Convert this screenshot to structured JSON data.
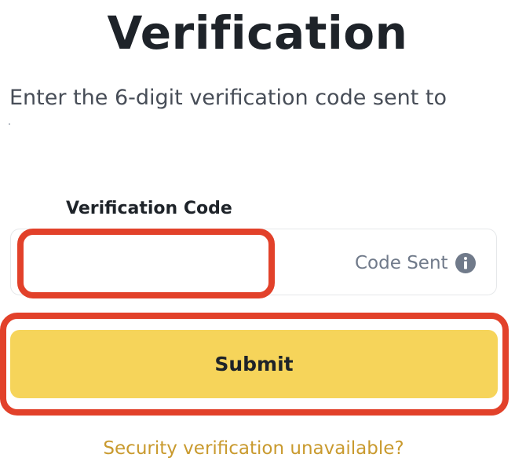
{
  "page": {
    "title": "Verification",
    "subtitle": "Enter the 6-digit verification code sent to"
  },
  "form": {
    "code_label": "Verification Code",
    "code_value": "",
    "code_status": "Code Sent",
    "submit_label": "Submit"
  },
  "links": {
    "unavailable": "Security verification unavailable?"
  },
  "icons": {
    "info": "info-icon"
  },
  "colors": {
    "primary_button": "#f6d45a",
    "link": "#c99a2e",
    "highlight": "#e2412a",
    "text": "#1e2329"
  }
}
